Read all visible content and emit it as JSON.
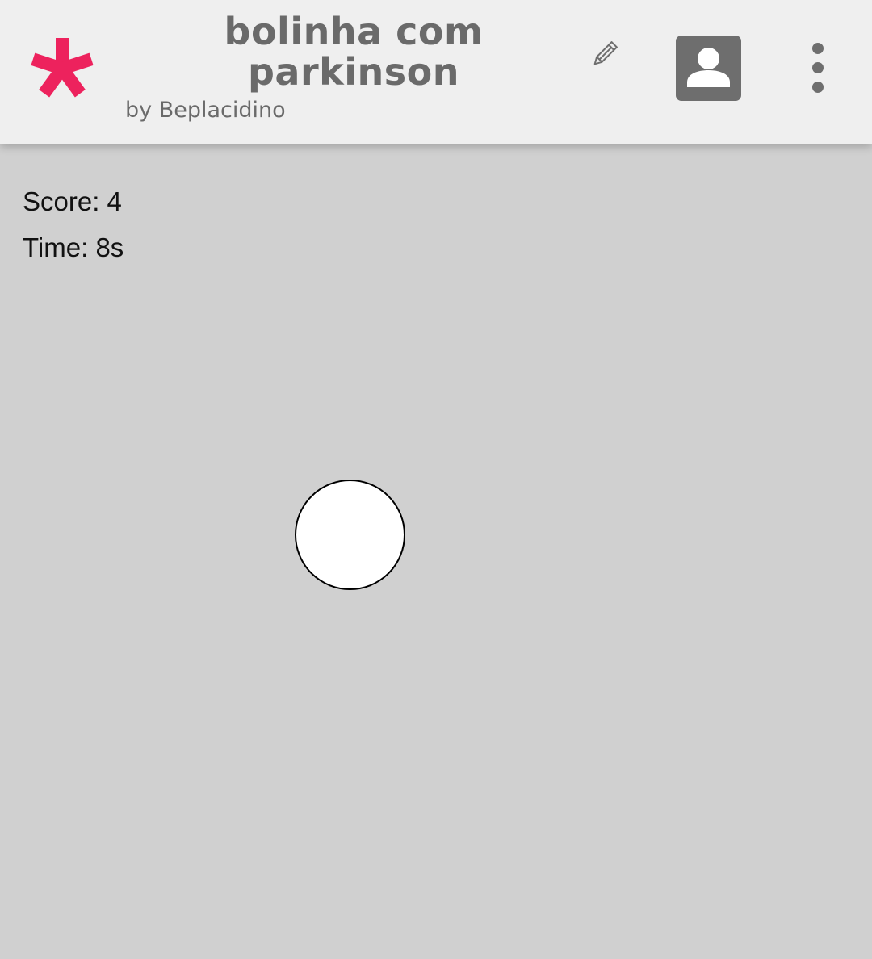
{
  "header": {
    "title_line1": "bolinha com",
    "title_line2": "parkinson",
    "byline": "by Beplacidino",
    "logo_icon": "asterisk-logo-icon",
    "edit_icon": "pencil-icon",
    "profile_icon": "user-avatar-icon",
    "menu_icon": "more-vertical-icon"
  },
  "game": {
    "score_text": "Score: 4",
    "time_text": "Time: 8s",
    "ball_icon": "circle-target"
  },
  "colors": {
    "accent": "#ed225d",
    "header_bg": "#efefef",
    "canvas_bg": "#d0d0d0",
    "icon_gray": "#6e6e6e",
    "ball_fill": "#ffffff",
    "ball_stroke": "#000000"
  }
}
